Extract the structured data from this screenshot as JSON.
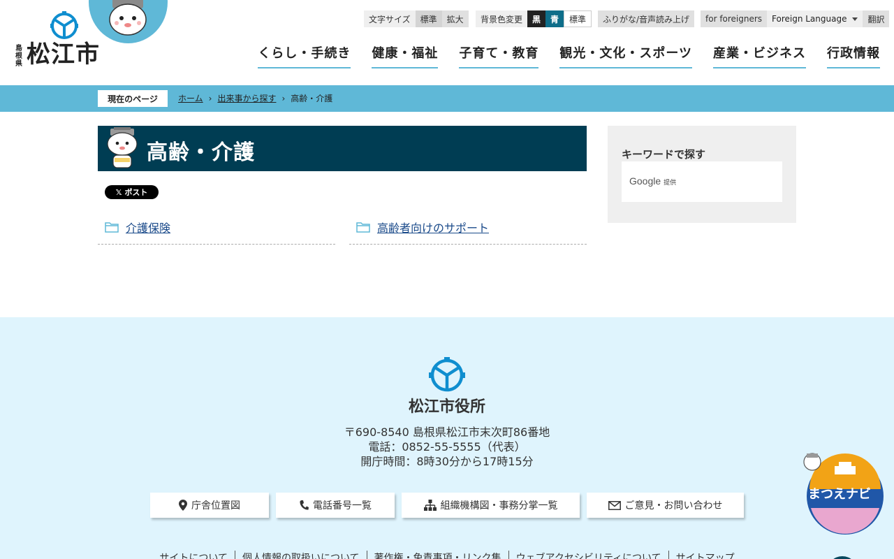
{
  "header": {
    "logo_pref": "島根県",
    "logo_city": "松江市",
    "text_size": {
      "label": "文字サイズ",
      "standard": "標準",
      "large": "拡大"
    },
    "bg_color": {
      "label": "背景色変更",
      "black": "黒",
      "blue": "青",
      "standard": "標準"
    },
    "furigana": "ふりがな/音声読み上げ",
    "foreigners": "for foreigners",
    "foreign_language": "Foreign Language",
    "translate": "翻訳",
    "nav": [
      "くらし・手続き",
      "健康・福祉",
      "子育て・教育",
      "観光・文化・スポーツ",
      "産業・ビジネス",
      "行政情報"
    ]
  },
  "breadcrumb": {
    "label": "現在のページ",
    "items": [
      "ホーム",
      "出来事から探す"
    ],
    "current": "高齢・介護"
  },
  "main": {
    "title": "高齢・介護",
    "post_label": "ポスト",
    "categories": [
      "介護保険",
      "高齢者向けのサポート"
    ]
  },
  "side": {
    "heading": "キーワードで探す",
    "google": "Google",
    "provided": "提供"
  },
  "footer": {
    "name": "松江市役所",
    "address": "〒690-8540 島根県松江市末次町86番地",
    "tel": "電話：0852-55-5555（代表）",
    "hours": "開庁時間：8時30分から17時15分",
    "buttons": [
      "庁舎位置図",
      "電話番号一覧",
      "組織機構図・事務分掌一覧",
      "ご意見・お問い合わせ"
    ],
    "links": [
      "サイトについて",
      "個人情報の取扱いについて",
      "著作権・免責事項・リンク集",
      "ウェブアクセシビリティについて",
      "サイトマップ"
    ],
    "navi": "まつえナビ"
  },
  "colors": {
    "accent": "#5fb8d7",
    "title_bg": "#003d53",
    "footer_bg": "#dff4fd"
  }
}
